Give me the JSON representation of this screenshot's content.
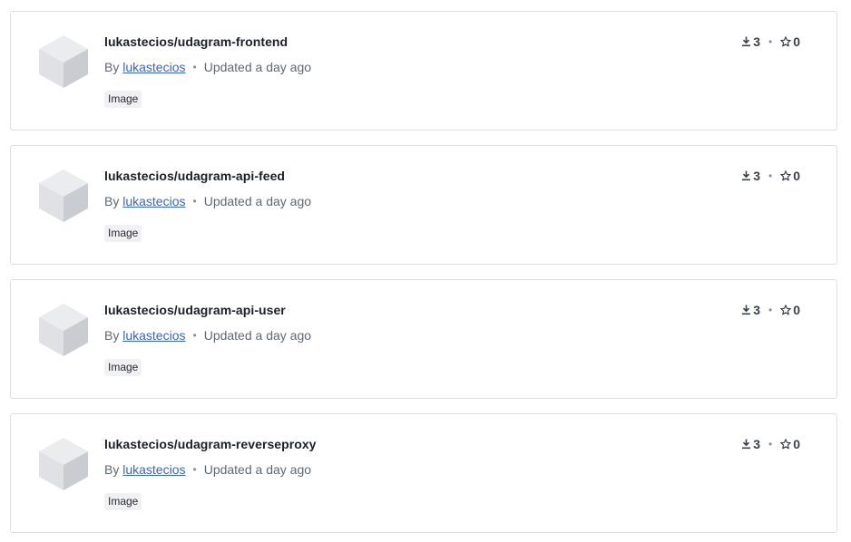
{
  "meta_separator": "•",
  "by_prefix": "By",
  "items": [
    {
      "name": "lukastecios/udagram-frontend",
      "author": "lukastecios",
      "updated": "Updated a day ago",
      "badge": "Image",
      "downloads": "3",
      "stars": "0"
    },
    {
      "name": "lukastecios/udagram-api-feed",
      "author": "lukastecios",
      "updated": "Updated a day ago",
      "badge": "Image",
      "downloads": "3",
      "stars": "0"
    },
    {
      "name": "lukastecios/udagram-api-user",
      "author": "lukastecios",
      "updated": "Updated a day ago",
      "badge": "Image",
      "downloads": "3",
      "stars": "0"
    },
    {
      "name": "lukastecios/udagram-reverseproxy",
      "author": "lukastecios",
      "updated": "Updated a day ago",
      "badge": "Image",
      "downloads": "3",
      "stars": "0"
    }
  ],
  "icons": {
    "thumbnail": "cube-icon",
    "downloads": "download-icon",
    "stars": "star-icon"
  },
  "colors": {
    "link": "#3a66b5",
    "badge_bg": "#f1f1f3",
    "border": "#dcdfe4"
  }
}
